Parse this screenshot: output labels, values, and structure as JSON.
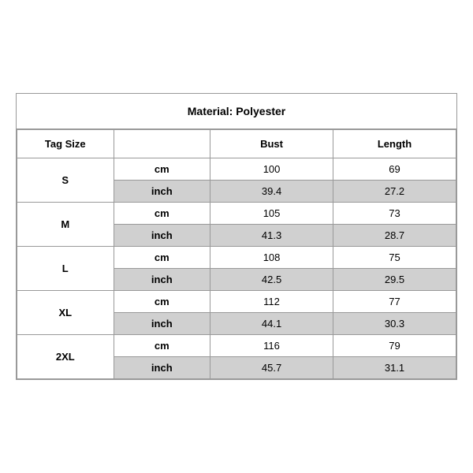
{
  "title": "Material: Polyester",
  "columns": {
    "tag_size": "Tag Size",
    "bust": "Bust",
    "length": "Length"
  },
  "sizes": [
    {
      "label": "S",
      "cm_bust": "100",
      "cm_length": "69",
      "inch_bust": "39.4",
      "inch_length": "27.2"
    },
    {
      "label": "M",
      "cm_bust": "105",
      "cm_length": "73",
      "inch_bust": "41.3",
      "inch_length": "28.7"
    },
    {
      "label": "L",
      "cm_bust": "108",
      "cm_length": "75",
      "inch_bust": "42.5",
      "inch_length": "29.5"
    },
    {
      "label": "XL",
      "cm_bust": "112",
      "cm_length": "77",
      "inch_bust": "44.1",
      "inch_length": "30.3"
    },
    {
      "label": "2XL",
      "cm_bust": "116",
      "cm_length": "79",
      "inch_bust": "45.7",
      "inch_length": "31.1"
    }
  ],
  "unit_cm": "cm",
  "unit_inch": "inch"
}
